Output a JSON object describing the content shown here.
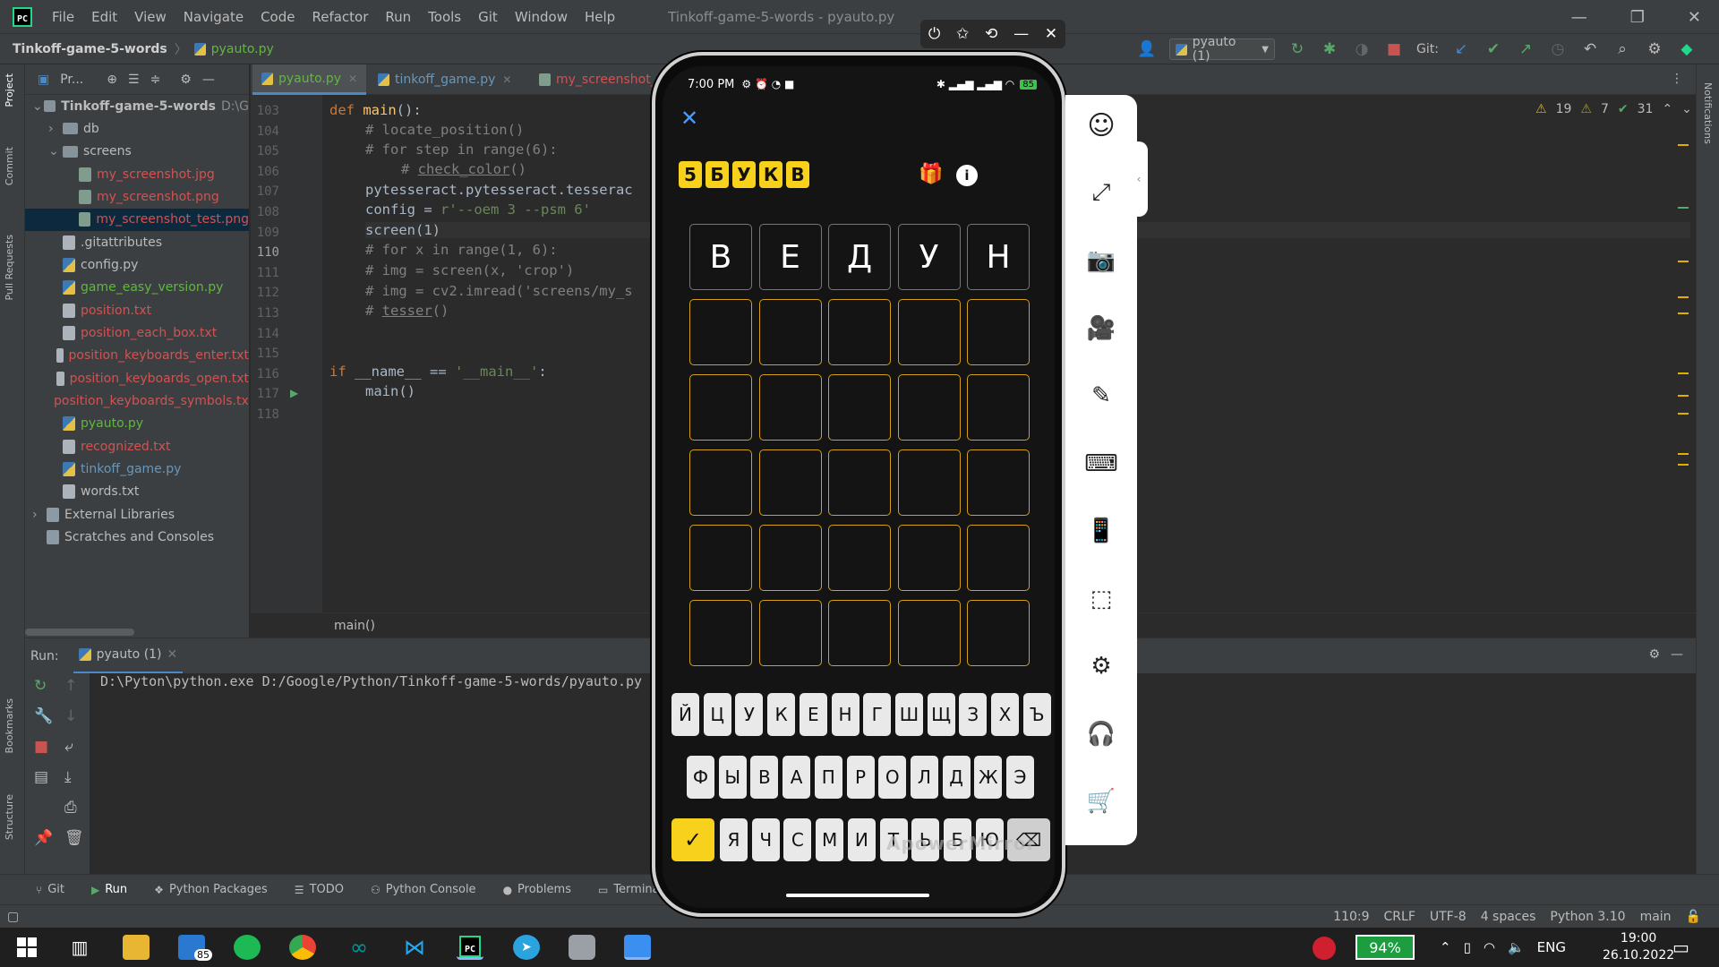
{
  "title_bar": {
    "logo": "PC",
    "menu": [
      "File",
      "Edit",
      "View",
      "Navigate",
      "Code",
      "Refactor",
      "Run",
      "Tools",
      "Git",
      "Window",
      "Help"
    ],
    "window_title": "Tinkoff-game-5-words - pyauto.py"
  },
  "nav_bar": {
    "project": "Tinkoff-game-5-words",
    "file": "pyauto.py",
    "run_config": "pyauto (1)",
    "git_label": "Git:"
  },
  "left_strip": [
    "Project",
    "Commit",
    "Pull Requests",
    "Bookmarks",
    "Structure"
  ],
  "right_strip": [
    "Notifications"
  ],
  "project_panel": {
    "header": "Pr...",
    "tree": [
      {
        "label": "Tinkoff-game-5-words",
        "suffix": "D:\\G",
        "icon": "dir",
        "depth": 0,
        "open": true,
        "bold": true,
        "color": "#bbbbbb"
      },
      {
        "label": "db",
        "icon": "dir",
        "depth": 1,
        "open": false,
        "color": "#bbbbbb"
      },
      {
        "label": "screens",
        "icon": "dir",
        "depth": 1,
        "open": true,
        "color": "#bbbbbb"
      },
      {
        "label": "my_screenshot.jpg",
        "icon": "img",
        "depth": 2,
        "color": "#d25252"
      },
      {
        "label": "my_screenshot.png",
        "icon": "img",
        "depth": 2,
        "color": "#d25252"
      },
      {
        "label": "my_screenshot_test.png",
        "icon": "img",
        "depth": 2,
        "color": "#d25252",
        "selected": true
      },
      {
        "label": ".gitattributes",
        "icon": "txt",
        "depth": 1,
        "color": "#bbbbbb"
      },
      {
        "label": "config.py",
        "icon": "py",
        "depth": 1,
        "color": "#bbbbbb"
      },
      {
        "label": "game_easy_version.py",
        "icon": "py",
        "depth": 1,
        "color": "#62b543"
      },
      {
        "label": "position.txt",
        "icon": "txt",
        "depth": 1,
        "color": "#d25252"
      },
      {
        "label": "position_each_box.txt",
        "icon": "txt",
        "depth": 1,
        "color": "#d25252"
      },
      {
        "label": "position_keyboards_enter.txt",
        "icon": "txt",
        "depth": 1,
        "color": "#d25252"
      },
      {
        "label": "position_keyboards_open.txt",
        "icon": "txt",
        "depth": 1,
        "color": "#d25252"
      },
      {
        "label": "position_keyboards_symbols.txt",
        "icon": "txt",
        "depth": 1,
        "color": "#d25252"
      },
      {
        "label": "pyauto.py",
        "icon": "py",
        "depth": 1,
        "color": "#62b543"
      },
      {
        "label": "recognized.txt",
        "icon": "txt",
        "depth": 1,
        "color": "#d25252"
      },
      {
        "label": "tinkoff_game.py",
        "icon": "py",
        "depth": 1,
        "color": "#6897bb"
      },
      {
        "label": "words.txt",
        "icon": "txt",
        "depth": 1,
        "color": "#bbbbbb"
      },
      {
        "label": "External Libraries",
        "icon": "lib",
        "depth": 0,
        "open": false,
        "color": "#bbbbbb"
      },
      {
        "label": "Scratches and Consoles",
        "icon": "lib",
        "depth": 0,
        "color": "#bbbbbb"
      }
    ]
  },
  "editor": {
    "tabs": [
      {
        "label": "pyauto.py",
        "active": true,
        "color": "#62b543"
      },
      {
        "label": "tinkoff_game.py",
        "active": false,
        "color": "#6897bb"
      },
      {
        "label": "my_screenshot_tes",
        "active": false,
        "color": "#d25252"
      }
    ],
    "inspections": {
      "warnings": "19",
      "weak": "7",
      "ok": "31"
    },
    "line_numbers": [
      "103",
      "104",
      "105",
      "106",
      "107",
      "108",
      "109",
      "110",
      "111",
      "112",
      "113",
      "114",
      "115",
      "116",
      "117",
      "118"
    ],
    "current_line": "110",
    "breadcrumb": "main()"
  },
  "run_panel": {
    "label": "Run:",
    "tab": "pyauto (1)",
    "output": "D:\\Pyton\\python.exe D:/Google/Python/Tinkoff-game-5-words/pyauto.py"
  },
  "tool_windows": [
    "Git",
    "Run",
    "Python Packages",
    "TODO",
    "Python Console",
    "Problems",
    "Terminal"
  ],
  "status_bar": [
    "110:9",
    "CRLF",
    "UTF-8",
    "4 spaces",
    "Python 3.10",
    "main"
  ],
  "phone": {
    "time": "7:00 PM",
    "battery_text": "85",
    "game_logo": [
      "5",
      "Б",
      "У",
      "К",
      "В"
    ],
    "grid": [
      [
        "В",
        "Е",
        "Д",
        "У",
        "Н"
      ],
      [
        "",
        "",
        "",
        "",
        ""
      ],
      [
        "",
        "",
        "",
        "",
        ""
      ],
      [
        "",
        "",
        "",
        "",
        ""
      ],
      [
        "",
        "",
        "",
        "",
        ""
      ],
      [
        "",
        "",
        "",
        "",
        ""
      ]
    ],
    "keyboard": {
      "row1": [
        "Й",
        "Ц",
        "У",
        "К",
        "Е",
        "Н",
        "Г",
        "Ш",
        "Щ",
        "З",
        "Х",
        "Ъ"
      ],
      "row2": [
        "Ф",
        "Ы",
        "В",
        "А",
        "П",
        "Р",
        "О",
        "Л",
        "Д",
        "Ж",
        "Э"
      ],
      "row3": [
        "Я",
        "Ч",
        "С",
        "М",
        "И",
        "Т",
        "Ь",
        "Б",
        "Ю"
      ]
    },
    "watermark": "ApowerMirror"
  },
  "mirror_panel": {
    "icons": [
      "avatar-icon",
      "fullscreen-icon",
      "screenshot-icon",
      "record-icon",
      "annotate-icon",
      "keyboard-icon",
      "phone-rotate-icon",
      "crop-icon",
      "settings-icon",
      "support-icon",
      "cart-icon"
    ]
  },
  "taskbar": {
    "mail_badge": "85",
    "battery": "94%",
    "language": "ENG",
    "time": "19:00",
    "date": "26.10.2022"
  },
  "colors": {
    "accent": "#4a88c7",
    "tile_yellow": "#f8d11c",
    "grid_border": "#d4a017",
    "ide_bg": "#2b2b2b"
  }
}
